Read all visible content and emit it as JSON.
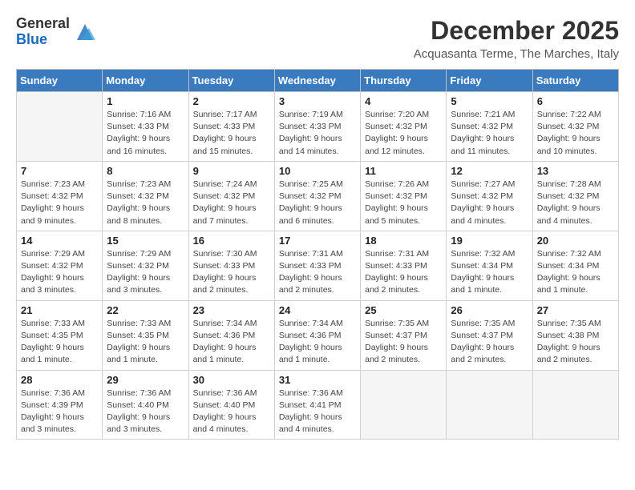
{
  "logo": {
    "general": "General",
    "blue": "Blue"
  },
  "title": "December 2025",
  "location": "Acquasanta Terme, The Marches, Italy",
  "headers": [
    "Sunday",
    "Monday",
    "Tuesday",
    "Wednesday",
    "Thursday",
    "Friday",
    "Saturday"
  ],
  "weeks": [
    [
      {
        "day": "",
        "info": ""
      },
      {
        "day": "1",
        "info": "Sunrise: 7:16 AM\nSunset: 4:33 PM\nDaylight: 9 hours\nand 16 minutes."
      },
      {
        "day": "2",
        "info": "Sunrise: 7:17 AM\nSunset: 4:33 PM\nDaylight: 9 hours\nand 15 minutes."
      },
      {
        "day": "3",
        "info": "Sunrise: 7:19 AM\nSunset: 4:33 PM\nDaylight: 9 hours\nand 14 minutes."
      },
      {
        "day": "4",
        "info": "Sunrise: 7:20 AM\nSunset: 4:32 PM\nDaylight: 9 hours\nand 12 minutes."
      },
      {
        "day": "5",
        "info": "Sunrise: 7:21 AM\nSunset: 4:32 PM\nDaylight: 9 hours\nand 11 minutes."
      },
      {
        "day": "6",
        "info": "Sunrise: 7:22 AM\nSunset: 4:32 PM\nDaylight: 9 hours\nand 10 minutes."
      }
    ],
    [
      {
        "day": "7",
        "info": "Sunrise: 7:23 AM\nSunset: 4:32 PM\nDaylight: 9 hours\nand 9 minutes."
      },
      {
        "day": "8",
        "info": "Sunrise: 7:23 AM\nSunset: 4:32 PM\nDaylight: 9 hours\nand 8 minutes."
      },
      {
        "day": "9",
        "info": "Sunrise: 7:24 AM\nSunset: 4:32 PM\nDaylight: 9 hours\nand 7 minutes."
      },
      {
        "day": "10",
        "info": "Sunrise: 7:25 AM\nSunset: 4:32 PM\nDaylight: 9 hours\nand 6 minutes."
      },
      {
        "day": "11",
        "info": "Sunrise: 7:26 AM\nSunset: 4:32 PM\nDaylight: 9 hours\nand 5 minutes."
      },
      {
        "day": "12",
        "info": "Sunrise: 7:27 AM\nSunset: 4:32 PM\nDaylight: 9 hours\nand 4 minutes."
      },
      {
        "day": "13",
        "info": "Sunrise: 7:28 AM\nSunset: 4:32 PM\nDaylight: 9 hours\nand 4 minutes."
      }
    ],
    [
      {
        "day": "14",
        "info": "Sunrise: 7:29 AM\nSunset: 4:32 PM\nDaylight: 9 hours\nand 3 minutes."
      },
      {
        "day": "15",
        "info": "Sunrise: 7:29 AM\nSunset: 4:32 PM\nDaylight: 9 hours\nand 3 minutes."
      },
      {
        "day": "16",
        "info": "Sunrise: 7:30 AM\nSunset: 4:33 PM\nDaylight: 9 hours\nand 2 minutes."
      },
      {
        "day": "17",
        "info": "Sunrise: 7:31 AM\nSunset: 4:33 PM\nDaylight: 9 hours\nand 2 minutes."
      },
      {
        "day": "18",
        "info": "Sunrise: 7:31 AM\nSunset: 4:33 PM\nDaylight: 9 hours\nand 2 minutes."
      },
      {
        "day": "19",
        "info": "Sunrise: 7:32 AM\nSunset: 4:34 PM\nDaylight: 9 hours\nand 1 minute."
      },
      {
        "day": "20",
        "info": "Sunrise: 7:32 AM\nSunset: 4:34 PM\nDaylight: 9 hours\nand 1 minute."
      }
    ],
    [
      {
        "day": "21",
        "info": "Sunrise: 7:33 AM\nSunset: 4:35 PM\nDaylight: 9 hours\nand 1 minute."
      },
      {
        "day": "22",
        "info": "Sunrise: 7:33 AM\nSunset: 4:35 PM\nDaylight: 9 hours\nand 1 minute."
      },
      {
        "day": "23",
        "info": "Sunrise: 7:34 AM\nSunset: 4:36 PM\nDaylight: 9 hours\nand 1 minute."
      },
      {
        "day": "24",
        "info": "Sunrise: 7:34 AM\nSunset: 4:36 PM\nDaylight: 9 hours\nand 1 minute."
      },
      {
        "day": "25",
        "info": "Sunrise: 7:35 AM\nSunset: 4:37 PM\nDaylight: 9 hours\nand 2 minutes."
      },
      {
        "day": "26",
        "info": "Sunrise: 7:35 AM\nSunset: 4:37 PM\nDaylight: 9 hours\nand 2 minutes."
      },
      {
        "day": "27",
        "info": "Sunrise: 7:35 AM\nSunset: 4:38 PM\nDaylight: 9 hours\nand 2 minutes."
      }
    ],
    [
      {
        "day": "28",
        "info": "Sunrise: 7:36 AM\nSunset: 4:39 PM\nDaylight: 9 hours\nand 3 minutes."
      },
      {
        "day": "29",
        "info": "Sunrise: 7:36 AM\nSunset: 4:40 PM\nDaylight: 9 hours\nand 3 minutes."
      },
      {
        "day": "30",
        "info": "Sunrise: 7:36 AM\nSunset: 4:40 PM\nDaylight: 9 hours\nand 4 minutes."
      },
      {
        "day": "31",
        "info": "Sunrise: 7:36 AM\nSunset: 4:41 PM\nDaylight: 9 hours\nand 4 minutes."
      },
      {
        "day": "",
        "info": ""
      },
      {
        "day": "",
        "info": ""
      },
      {
        "day": "",
        "info": ""
      }
    ]
  ]
}
